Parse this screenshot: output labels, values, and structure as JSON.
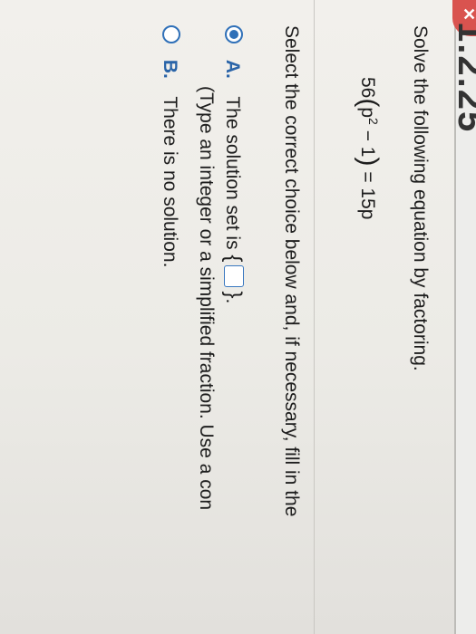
{
  "header": {
    "section_number": "1.2.25"
  },
  "question": {
    "prompt": "Solve the following equation by factoring.",
    "equation": {
      "coef": "56",
      "inner_var": "p",
      "inner_exp": "2",
      "inner_rest": "− 1",
      "rhs": "= 15p"
    }
  },
  "instruction": "Select the correct choice below and, if necessary, fill in the",
  "choices": [
    {
      "letter": "A.",
      "text": "The solution set is",
      "selected": true,
      "hint": "(Type an integer or a simplified fraction. Use a con"
    },
    {
      "letter": "B.",
      "text": "There is no solution.",
      "selected": false
    }
  ],
  "colors": {
    "accent": "#2f70b8",
    "error": "#d9534f"
  },
  "icons": {
    "error_badge": "x-icon",
    "radio_checked": "radio-checked-icon",
    "radio_unchecked": "radio-unchecked-icon"
  }
}
